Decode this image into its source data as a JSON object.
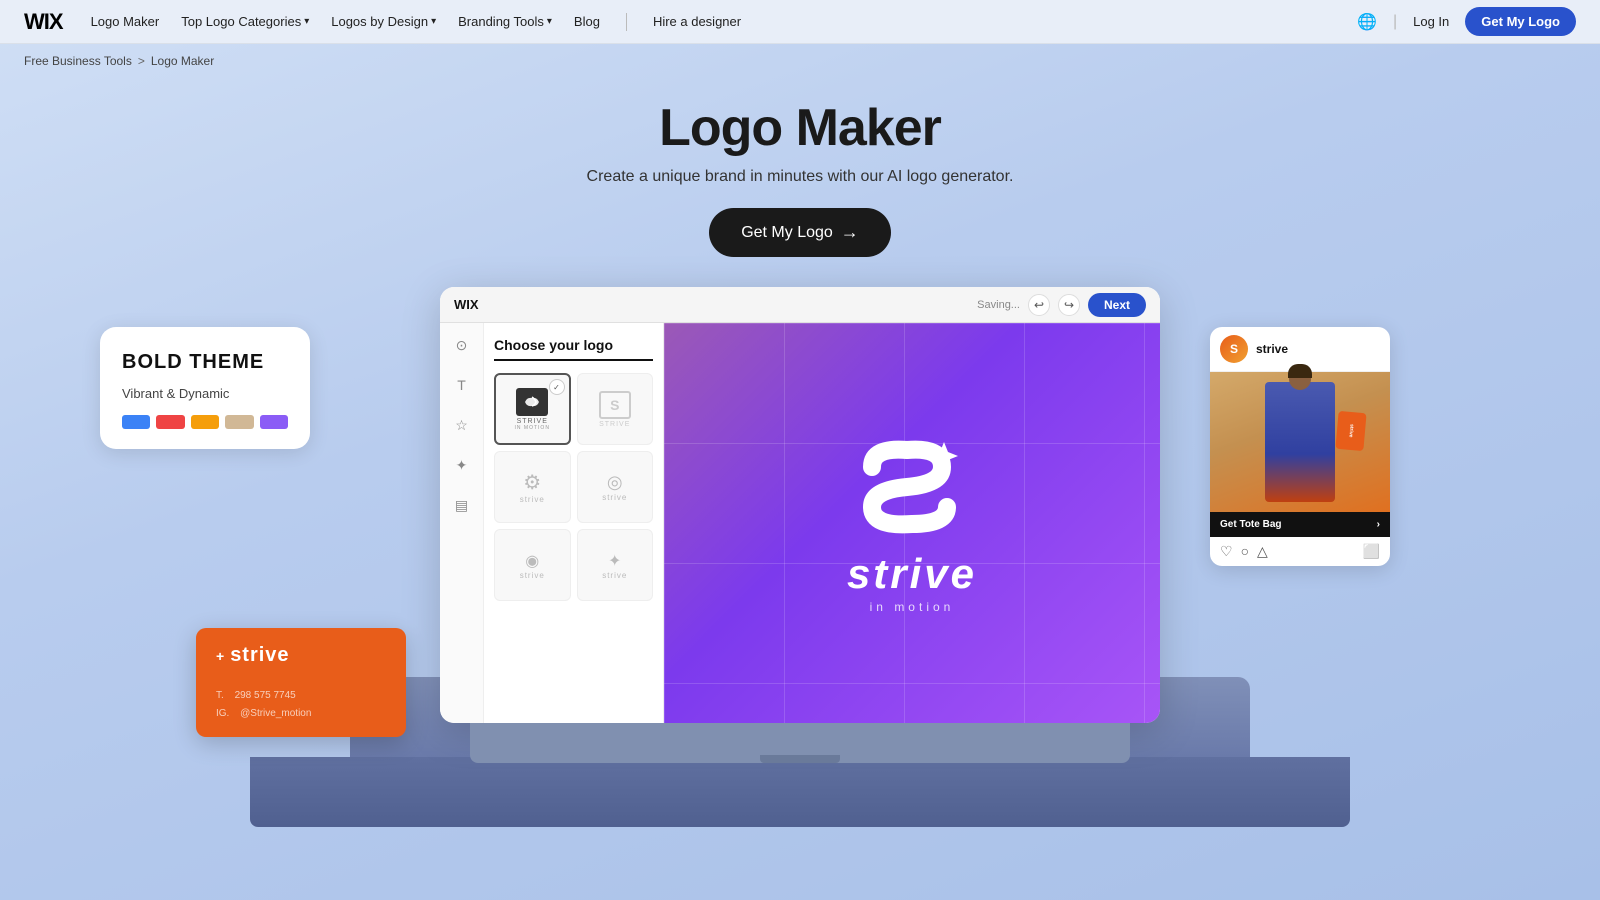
{
  "nav": {
    "logo": "WIX",
    "links": [
      {
        "label": "Logo Maker",
        "hasDropdown": false
      },
      {
        "label": "Top Logo Categories",
        "hasDropdown": true
      },
      {
        "label": "Logos by Design",
        "hasDropdown": true
      },
      {
        "label": "Branding Tools",
        "hasDropdown": true
      },
      {
        "label": "Blog",
        "hasDropdown": false
      },
      {
        "label": "Hire a designer",
        "hasDropdown": false
      }
    ],
    "login": "Log In",
    "cta": "Get My Logo"
  },
  "breadcrumb": {
    "items": [
      "Free Business Tools",
      "Logo Maker"
    ],
    "separator": ">"
  },
  "hero": {
    "title": "Logo Maker",
    "subtitle": "Create a unique brand in minutes with our AI logo generator.",
    "cta": "Get My Logo",
    "cta_arrow": "→"
  },
  "editor": {
    "brand": "WIX",
    "saving": "Saving...",
    "next_btn": "Next",
    "panel_title": "Choose your logo",
    "logo_options": [
      {
        "id": 1,
        "selected": true
      },
      {
        "id": 2,
        "selected": false
      },
      {
        "id": 3,
        "selected": false
      },
      {
        "id": 4,
        "selected": false
      },
      {
        "id": 5,
        "selected": false
      },
      {
        "id": 6,
        "selected": false
      }
    ],
    "canvas_brand": "strive",
    "canvas_tagline": "in motion"
  },
  "bold_theme": {
    "title": "BOLD THEME",
    "subtitle": "Vibrant & Dynamic",
    "swatches": [
      "#3b82f6",
      "#ef4444",
      "#f59e0b",
      "#d1b896",
      "#8b5cf6"
    ]
  },
  "business_card": {
    "plus": "+",
    "name": "strive",
    "phone_label": "T.",
    "phone": "298 575 7745",
    "ig_label": "IG.",
    "ig": "@Strive_motion"
  },
  "instagram_card": {
    "avatar_letter": "S",
    "username": "strive",
    "cta_text": "Get Tote Bag",
    "cta_arrow": "›"
  }
}
